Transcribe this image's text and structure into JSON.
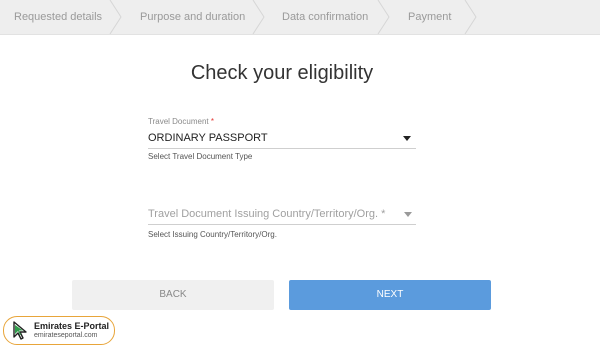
{
  "stepper": {
    "steps": [
      {
        "label": "Requested details"
      },
      {
        "label": "Purpose and duration"
      },
      {
        "label": "Data confirmation"
      },
      {
        "label": "Payment"
      }
    ]
  },
  "page": {
    "title": "Check your eligibility"
  },
  "form": {
    "travel_document": {
      "label": "Travel Document",
      "required_mark": "*",
      "value": "ORDINARY PASSPORT",
      "helper": "Select Travel Document Type"
    },
    "issuing_country": {
      "placeholder": "Travel Document Issuing Country/Territory/Org. *",
      "helper": "Select Issuing Country/Territory/Org."
    }
  },
  "buttons": {
    "back": "BACK",
    "next": "NEXT"
  },
  "watermark": {
    "title": "Emirates E-Portal",
    "subtitle": "emirateseportal.com",
    "icon": "cursor-arrow-icon"
  },
  "colors": {
    "primary_button": "#5b9bdd",
    "secondary_button": "#f0f0f0",
    "required": "#e53935",
    "logo_border": "#e8a53a"
  }
}
